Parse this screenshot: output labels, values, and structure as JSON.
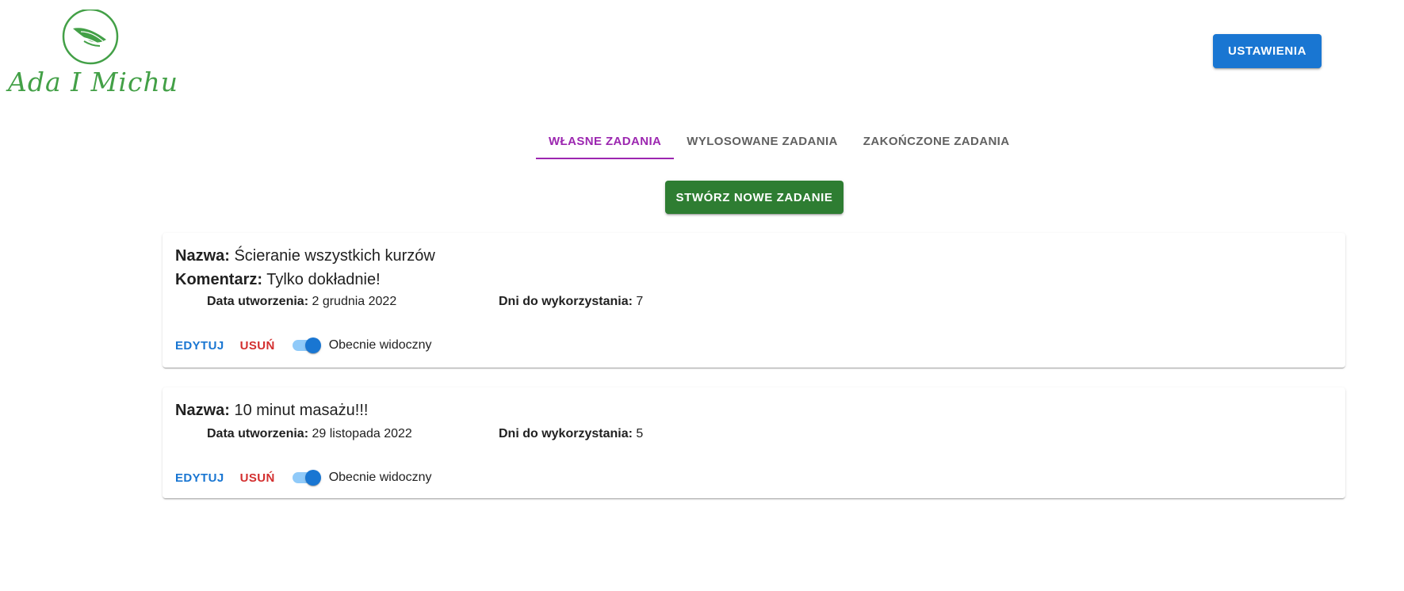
{
  "logo": {
    "text": "Ada I Michu",
    "icon": "leaf-icon",
    "color": "#43a047"
  },
  "header": {
    "settings_label": "USTAWIENIA"
  },
  "tabs": [
    {
      "label": "WŁASNE ZADANIA",
      "active": true
    },
    {
      "label": "WYLOSOWANE ZADANIA",
      "active": false
    },
    {
      "label": "ZAKOŃCZONE ZADANIA",
      "active": false
    }
  ],
  "create_button": {
    "label": "STWÓRZ NOWE ZADANIE"
  },
  "labels": {
    "name": "Nazwa:",
    "comment": "Komentarz:",
    "created": "Data utworzenia:",
    "days_left": "Dni do wykorzystania:",
    "edit": "EDYTUJ",
    "delete": "USUŃ",
    "visible": "Obecnie widoczny"
  },
  "tasks": [
    {
      "name": "Ścieranie wszystkich kurzów",
      "comment": "Tylko dokładnie!",
      "created": "2 grudnia 2022",
      "days_left": "7",
      "visible": true
    },
    {
      "name": "10 minut masażu!!!",
      "created": "29 listopada 2022",
      "days_left": "5",
      "visible": true
    }
  ],
  "colors": {
    "primary": "#1976d2",
    "secondary": "#9c27b0",
    "success": "#2e7d32",
    "error": "#d32f2f"
  }
}
